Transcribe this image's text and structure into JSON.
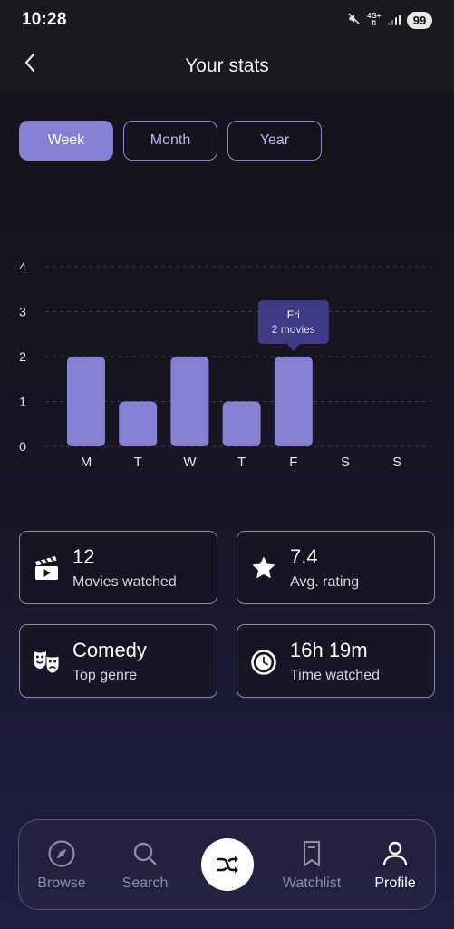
{
  "status_bar": {
    "time": "10:28",
    "network_top": "4G+",
    "battery": "99"
  },
  "header": {
    "title": "Your stats"
  },
  "tabs": [
    {
      "label": "Week",
      "active": true
    },
    {
      "label": "Month",
      "active": false
    },
    {
      "label": "Year",
      "active": false
    }
  ],
  "chart_data": {
    "type": "bar",
    "categories": [
      "M",
      "T",
      "W",
      "T",
      "F",
      "S",
      "S"
    ],
    "values": [
      2,
      1,
      2,
      1,
      2,
      0,
      0
    ],
    "ylim": [
      0,
      4
    ],
    "yticks": [
      0,
      1,
      2,
      3,
      4
    ],
    "grid": true,
    "bar_color": "#8480d4",
    "tooltip": {
      "category_index": 4,
      "title": "Fri",
      "subtitle": "2 movies"
    }
  },
  "stats": {
    "movies": {
      "value": "12",
      "label": "Movies watched",
      "icon": "clapperboard-icon"
    },
    "rating": {
      "value": "7.4",
      "label": "Avg. rating",
      "icon": "star-icon"
    },
    "genre": {
      "value": "Comedy",
      "label": "Top genre",
      "icon": "theater-masks-icon"
    },
    "time": {
      "value": "16h 19m",
      "label": "Time watched",
      "icon": "clock-icon"
    }
  },
  "nav": {
    "browse": "Browse",
    "search": "Search",
    "watchlist": "Watchlist",
    "profile": "Profile",
    "active": "profile"
  },
  "colors": {
    "accent": "#8480d4",
    "header_bg": "#1a191f"
  }
}
